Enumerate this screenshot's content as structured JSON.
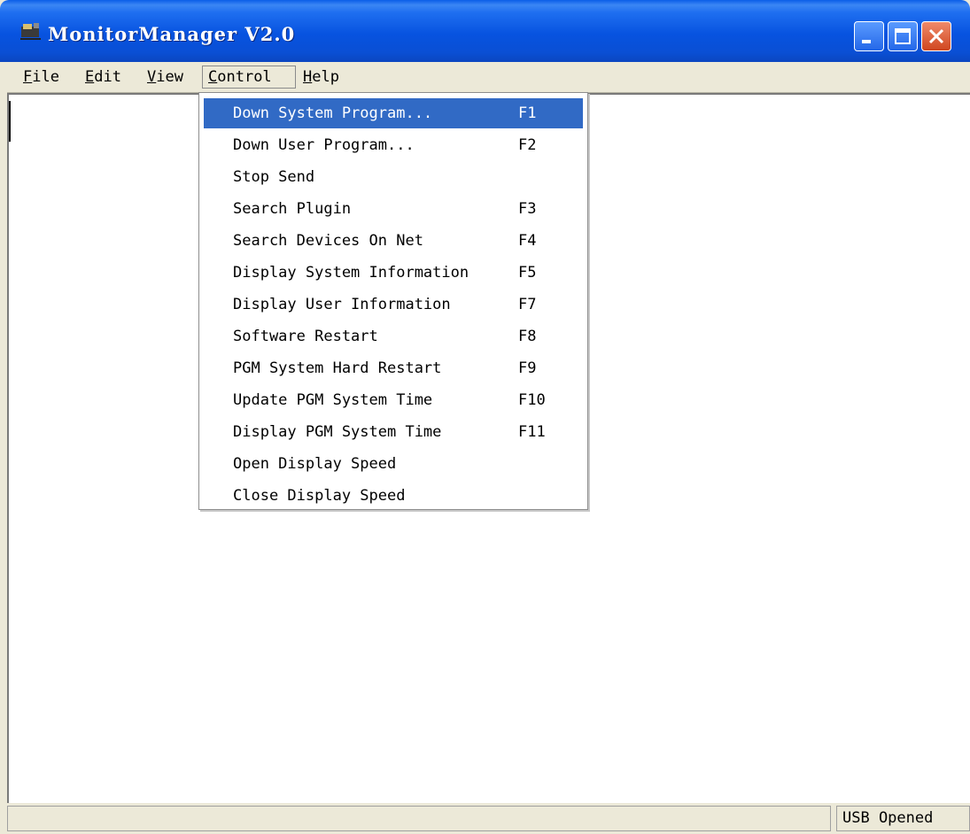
{
  "window": {
    "title": "MonitorManager V2.0",
    "titlebar_color": "#0a5ee8",
    "close_color": "#d0461f"
  },
  "menubar": {
    "items": [
      {
        "label": "File",
        "mnemonic": "F"
      },
      {
        "label": "Edit",
        "mnemonic": "E"
      },
      {
        "label": "View",
        "mnemonic": "V"
      },
      {
        "label": "Control",
        "mnemonic": "C"
      },
      {
        "label": "Help",
        "mnemonic": "H"
      }
    ],
    "active": "Control"
  },
  "control_menu": {
    "highlight_color": "#316ac5",
    "items": [
      {
        "label": "Down System Program...",
        "shortcut": "F1"
      },
      {
        "label": "Down User Program...",
        "shortcut": "F2"
      },
      {
        "label": "Stop Send",
        "shortcut": ""
      },
      {
        "label": "Search Plugin",
        "shortcut": "F3"
      },
      {
        "label": "Search Devices On Net",
        "shortcut": "F4"
      },
      {
        "label": "Display System Information",
        "shortcut": "F5"
      },
      {
        "label": "Display User Information",
        "shortcut": "F7"
      },
      {
        "label": "Software Restart",
        "shortcut": "F8"
      },
      {
        "label": "PGM System Hard Restart",
        "shortcut": "F9"
      },
      {
        "label": "Update PGM System Time",
        "shortcut": "F10"
      },
      {
        "label": "Display PGM System Time",
        "shortcut": "F11"
      },
      {
        "label": "Open Display Speed",
        "shortcut": ""
      },
      {
        "label": "Close Display Speed",
        "shortcut": ""
      }
    ]
  },
  "statusbar": {
    "panel_text": "USB Opened"
  },
  "icons": {
    "app": "monitor-app-icon",
    "minimize": "minimize-icon",
    "maximize": "maximize-icon",
    "close": "close-icon"
  }
}
